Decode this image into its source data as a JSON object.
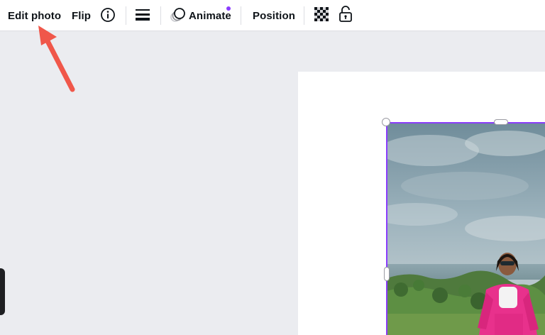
{
  "toolbar": {
    "edit_photo": "Edit photo",
    "flip": "Flip",
    "animate": "Animate",
    "position": "Position"
  },
  "icons": {
    "info": "info-circle-icon",
    "border_style": "border-lines-icon",
    "animate": "animate-circles-icon",
    "transparency": "checkerboard-icon",
    "lock": "unlocked-padlock-icon"
  },
  "colors": {
    "selection": "#8b3dff",
    "annotation_arrow": "#f0574a",
    "animate_dot": "#8b3dff"
  }
}
